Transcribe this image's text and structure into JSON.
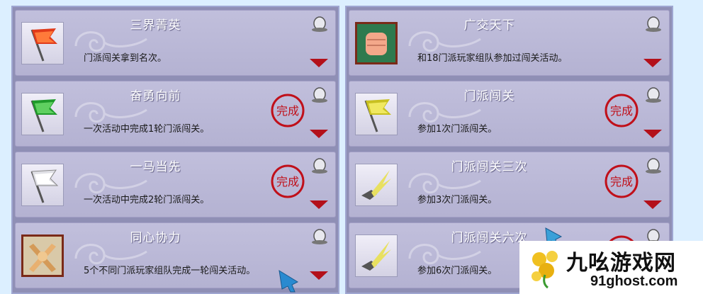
{
  "left_panel": {
    "cards": [
      {
        "title": "三界菁英",
        "desc": "门派闯关拿到名次。",
        "completed": false,
        "icon": "red-flag-icon"
      },
      {
        "title": "奋勇向前",
        "desc": "一次活动中完成1轮门派闯关。",
        "completed": true,
        "icon": "green-flag-icon"
      },
      {
        "title": "一马当先",
        "desc": "一次活动中完成2轮门派闯关。",
        "completed": true,
        "icon": "white-flag-icon"
      },
      {
        "title": "同心协力",
        "desc": "5个不同门派玩家组队完成一轮闯关活动。",
        "completed": false,
        "icon": "crossed-hands-icon"
      }
    ]
  },
  "right_panel": {
    "cards": [
      {
        "title": "广交天下",
        "desc": "和18门派玩家组队参加过闯关活动。",
        "completed": false,
        "icon": "fist-icon"
      },
      {
        "title": "门派闯关",
        "desc": "参加1次门派闯关。",
        "completed": true,
        "icon": "yellow-flag-icon"
      },
      {
        "title": "门派闯关三次",
        "desc": "参加3次门派闯关。",
        "completed": true,
        "icon": "lightning-boot-icon"
      },
      {
        "title": "门派闯关六次",
        "desc": "参加6次门派闯关。",
        "completed": true,
        "icon": "lightning-boot-icon"
      }
    ]
  },
  "stamp_text": "完成",
  "watermark": {
    "title": "九吆游戏网",
    "url": "91ghost.com"
  },
  "colors": {
    "panel": "#8f8fb5",
    "card": "#b4b2d2",
    "title": "#ffffff",
    "arrow": "#b3101a",
    "stamp": "#c0101a"
  }
}
